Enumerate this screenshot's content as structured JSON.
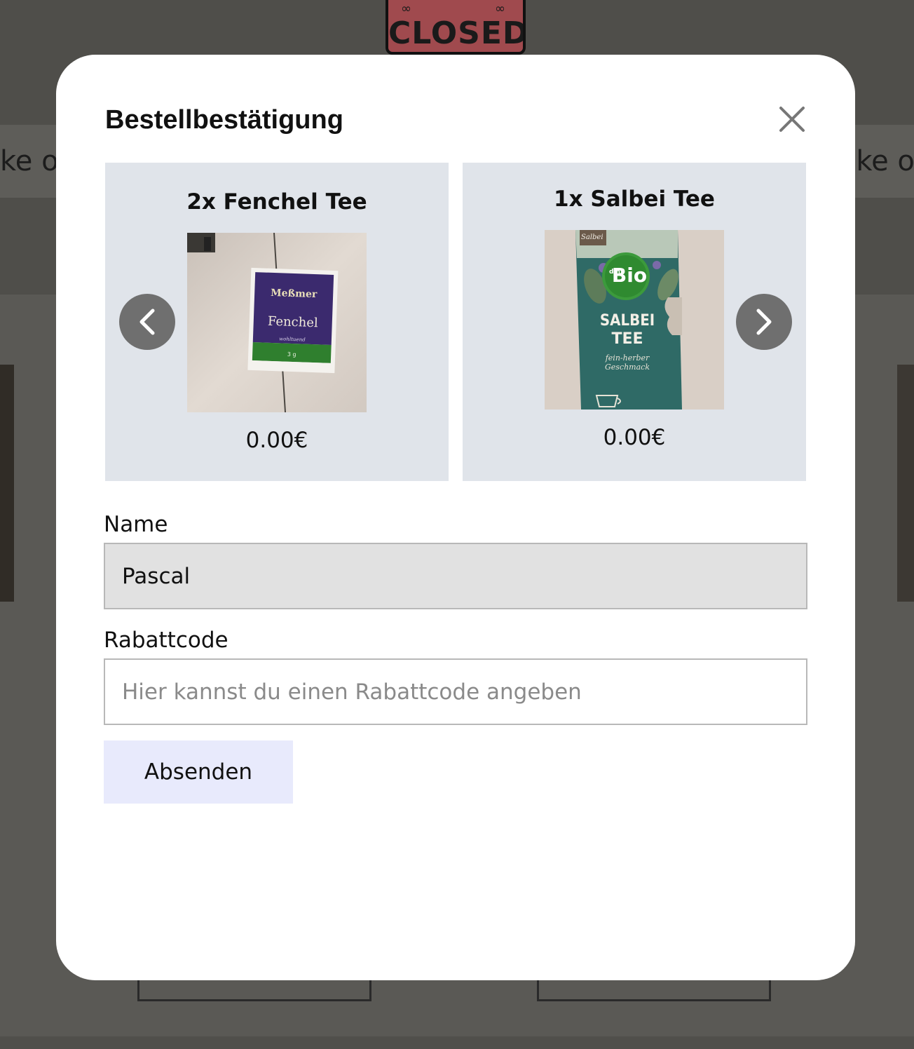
{
  "background": {
    "sign_text": "CLOSED",
    "banner_left_text": "ke o",
    "banner_right_text": "nke o"
  },
  "modal": {
    "title": "Bestellbestätigung",
    "close_icon": "close-icon"
  },
  "carousel": {
    "prev_icon": "chevron-left-icon",
    "next_icon": "chevron-right-icon",
    "items": [
      {
        "title": "2x Fenchel Tee",
        "price": "0.00€",
        "image_name": "fenchel-tee-image",
        "package_brand": "Meßmer",
        "package_name": "Fenchel",
        "package_sub": "wohltuend",
        "package_weight": "3 g"
      },
      {
        "title": "1x Salbei Tee",
        "price": "0.00€",
        "image_name": "salbei-tee-image",
        "package_top": "Salbei",
        "package_brand_small": "dm",
        "package_brand": "Bio",
        "package_name_1": "SALBEI",
        "package_name_2": "TEE",
        "package_sub_1": "fein-herber",
        "package_sub_2": "Geschmack"
      }
    ]
  },
  "form": {
    "name_label": "Name",
    "name_value": "Pascal",
    "rabatt_label": "Rabattcode",
    "rabatt_placeholder": "Hier kannst du einen Rabattcode angeben",
    "rabatt_value": "",
    "submit_label": "Absenden"
  },
  "colors": {
    "overlay": "#4b4a46",
    "modal_bg": "#ffffff",
    "slide_bg": "#e0e4ea",
    "nav_button": "#6f6f6f",
    "name_input_bg": "#e1e1e1",
    "submit_bg": "#e8eafc"
  }
}
